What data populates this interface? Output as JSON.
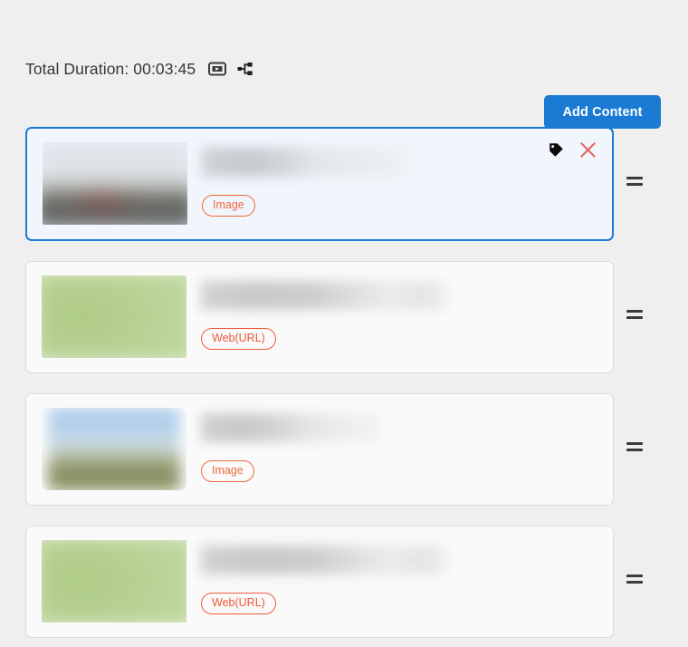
{
  "header": {
    "duration_label": "Total Duration: 00:03:45",
    "icons": [
      {
        "name": "media-player-icon",
        "label": "Media Player"
      },
      {
        "name": "share-nodes-icon",
        "label": "Share"
      }
    ],
    "add_content_label": "Add Content"
  },
  "colors": {
    "page_background": "#efeff0",
    "accent_blue": "#1b7ad4",
    "selected_border": "#1c7ad2",
    "selected_background": "#f1f6fd",
    "badge_image": "#ee6a3e",
    "badge_web": "#f0593a",
    "close_red": "#e8635f",
    "card_background": "#fafafa",
    "card_border": "#dcdcdc"
  },
  "content_items": [
    {
      "index": 1,
      "selected": true,
      "badge": "Image",
      "badge_type": "image",
      "thumbnail": "city-photo-thumbnail",
      "title_redacted": true,
      "actions": [
        {
          "name": "tag-icon",
          "label": "Tag"
        },
        {
          "name": "close-icon",
          "label": "Remove"
        }
      ],
      "drag_handle": "reorder-handle"
    },
    {
      "index": 2,
      "selected": false,
      "badge": "Web(URL)",
      "badge_type": "web",
      "thumbnail": "green-page-thumbnail",
      "title_redacted": true,
      "actions": [],
      "drag_handle": "reorder-handle"
    },
    {
      "index": 3,
      "selected": false,
      "badge": "Image",
      "badge_type": "image",
      "thumbnail": "landscape-photo-thumbnail",
      "title_redacted": true,
      "actions": [],
      "drag_handle": "reorder-handle"
    },
    {
      "index": 4,
      "selected": false,
      "badge": "Web(URL)",
      "badge_type": "web",
      "thumbnail": "green-page-thumbnail",
      "title_redacted": true,
      "actions": [],
      "drag_handle": "reorder-handle"
    }
  ]
}
